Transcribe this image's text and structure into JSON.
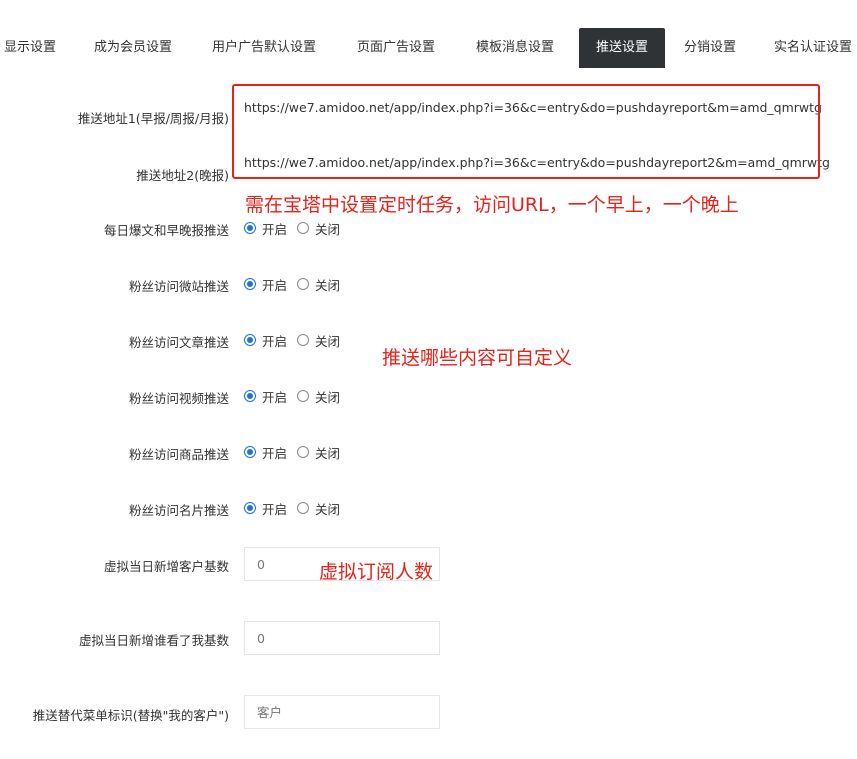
{
  "tabs": [
    {
      "label": "显示设置",
      "active": false
    },
    {
      "label": "成为会员设置",
      "active": false
    },
    {
      "label": "用户广告默认设置",
      "active": false
    },
    {
      "label": "页面广告设置",
      "active": false
    },
    {
      "label": "模板消息设置",
      "active": false
    },
    {
      "label": "推送设置",
      "active": true
    },
    {
      "label": "分销设置",
      "active": false
    },
    {
      "label": "实名认证设置",
      "active": false
    }
  ],
  "push_urls": {
    "url1_label": "推送地址1(早报/周报/月报)",
    "url1_value": "https://we7.amidoo.net/app/index.php?i=36&c=entry&do=pushdayreport&m=amd_qmrwtg",
    "url2_label": "推送地址2(晚报)",
    "url2_value": "https://we7.amidoo.net/app/index.php?i=36&c=entry&do=pushdayreport2&m=amd_qmrwtg"
  },
  "annotations": {
    "cron_note": "需在宝塔中设置定时任务，访问URL，一个早上，一个晚上",
    "custom_note": "推送哪些内容可自定义",
    "virtual_note": "虚拟订阅人数"
  },
  "options": {
    "on_label": "开启",
    "off_label": "关闭"
  },
  "toggles": [
    {
      "label": "每日爆文和早晚报推送",
      "value": "on"
    },
    {
      "label": "粉丝访问微站推送",
      "value": "on"
    },
    {
      "label": "粉丝访问文章推送",
      "value": "on"
    },
    {
      "label": "粉丝访问视频推送",
      "value": "on"
    },
    {
      "label": "粉丝访问商品推送",
      "value": "on"
    },
    {
      "label": "粉丝访问名片推送",
      "value": "on"
    }
  ],
  "fields": {
    "virtual_customers_label": "虚拟当日新增客户基数",
    "virtual_customers_placeholder": "0",
    "virtual_viewers_label": "虚拟当日新增谁看了我基数",
    "virtual_viewers_placeholder": "0",
    "menu_alias_label": "推送替代菜单标识(替换\"我的客户\")",
    "menu_alias_placeholder": "客户"
  },
  "colors": {
    "accent_red": "#e8211a",
    "active_tab_bg": "#2f3336",
    "radio_blue": "#1a73e8"
  }
}
